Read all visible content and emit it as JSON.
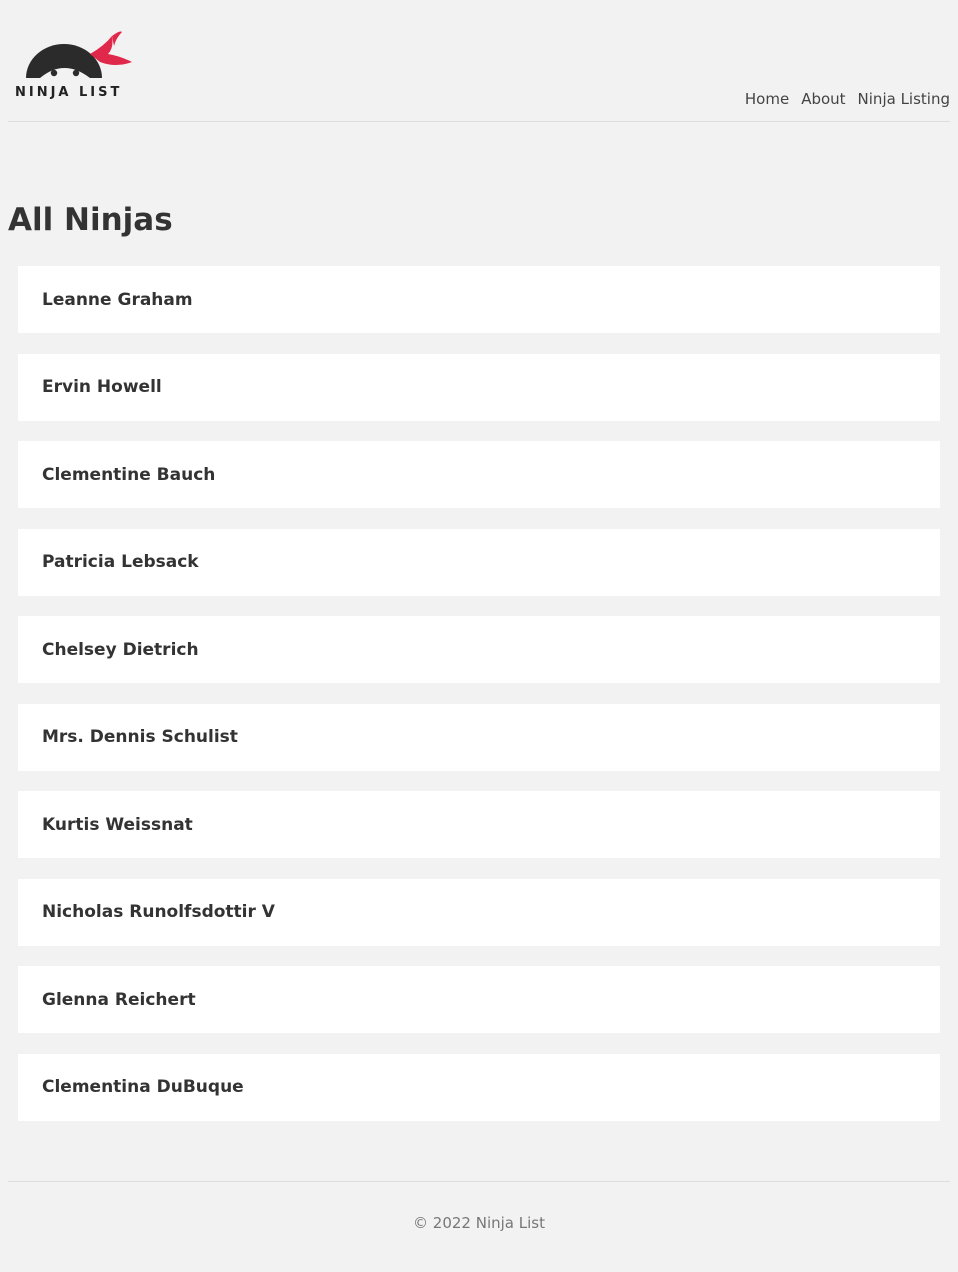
{
  "header": {
    "logo_text": "NINJA LIST",
    "nav": [
      {
        "label": "Home"
      },
      {
        "label": "About"
      },
      {
        "label": "Ninja Listing"
      }
    ]
  },
  "main": {
    "title": "All Ninjas",
    "ninjas": [
      {
        "name": "Leanne Graham"
      },
      {
        "name": "Ervin Howell"
      },
      {
        "name": "Clementine Bauch"
      },
      {
        "name": "Patricia Lebsack"
      },
      {
        "name": "Chelsey Dietrich"
      },
      {
        "name": "Mrs. Dennis Schulist"
      },
      {
        "name": "Kurtis Weissnat"
      },
      {
        "name": "Nicholas Runolfsdottir V"
      },
      {
        "name": "Glenna Reichert"
      },
      {
        "name": "Clementina DuBuque"
      }
    ]
  },
  "footer": {
    "text": "© 2022 Ninja List"
  },
  "colors": {
    "background": "#f2f2f2",
    "card": "#ffffff",
    "text": "#333333",
    "logo_dark": "#2b2b2b",
    "logo_accent": "#e0284a"
  }
}
